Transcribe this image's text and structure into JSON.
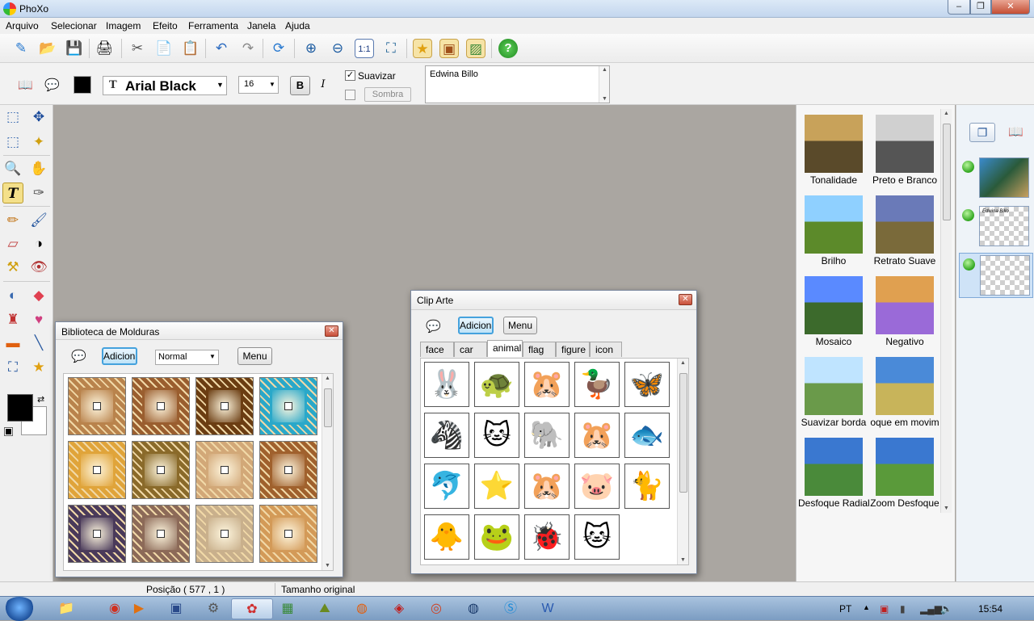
{
  "app": {
    "title": "PhoXo"
  },
  "window_controls": {
    "minimize": "–",
    "restore": "❐",
    "close": "✕"
  },
  "menu": [
    "Arquivo",
    "Selecionar",
    "Imagem",
    "Efeito",
    "Ferramenta",
    "Janela",
    "Ajuda"
  ],
  "toolbar_icons": [
    "new-icon",
    "open-icon",
    "save-icon",
    "scan-icon",
    "cut-icon",
    "copy-icon",
    "paste-icon",
    "undo-icon",
    "redo-icon",
    "rotate-icon",
    "zoom-in-icon",
    "zoom-out-icon",
    "actual-size-icon",
    "fit-window-icon",
    "clipart-icon",
    "frame-icon",
    "effects-icon",
    "help-icon"
  ],
  "text_options": {
    "font_name": "Arial Black",
    "font_size": "16",
    "bold": "B",
    "italic": "I",
    "smooth_label": "Suavizar",
    "shadow_label": "Sombra",
    "text_value": "Edwina Billo",
    "text_color": "#000000"
  },
  "colors": {
    "foreground": "#000000",
    "background": "#ffffff"
  },
  "frames_dialog": {
    "title": "Biblioteca de Molduras",
    "add_button": "Adicionar",
    "mode_select": "Normal",
    "menu_button": "Menu",
    "frame_colors": [
      "#b9834c",
      "#9a5e2f",
      "#6b3d12",
      "#2aa8c9",
      "#e0a43a",
      "#8a6a2a",
      "#d2a878",
      "#a0612d",
      "#4a3a5a",
      "#8c6a58",
      "#c9b08c",
      "#d39a58"
    ]
  },
  "clipart_dialog": {
    "title": "Clip Arte",
    "add_button": "Adicionar",
    "menu_button": "Menu",
    "tabs": [
      "face",
      "car",
      "animal",
      "flag",
      "figure",
      "icon"
    ],
    "selected_tab": "animal",
    "items": [
      "🐰",
      "🐢",
      "🐹",
      "🦆",
      "🦋",
      "🦓",
      "🐱",
      "🐘",
      "🐹",
      "🐟",
      "🐬",
      "⭐",
      "🐹",
      "🐷",
      "🐈",
      "🐥",
      "🐸",
      "🐞",
      "🐱"
    ]
  },
  "effects": [
    {
      "label": "Tonalidade",
      "c1": "#c8a25a",
      "c2": "#5a4a2a"
    },
    {
      "label": "Preto e Branco",
      "c1": "#d0d0d0",
      "c2": "#555555"
    },
    {
      "label": "Brilho",
      "c1": "#8fd0ff",
      "c2": "#5c8a2a"
    },
    {
      "label": "Retrato Suave",
      "c1": "#6a7ab8",
      "c2": "#7a6a3a"
    },
    {
      "label": "Mosaico",
      "c1": "#5a8aff",
      "c2": "#3c6a2c"
    },
    {
      "label": "Negativo",
      "c1": "#e0a050",
      "c2": "#9a6ad8"
    },
    {
      "label": "Suavizar borda",
      "c1": "#bfe4ff",
      "c2": "#6a9a4a"
    },
    {
      "label": "oque em movim",
      "c1": "#4a8ad8",
      "c2": "#c8b45a"
    },
    {
      "label": "Desfoque Radial",
      "c1": "#3a78d0",
      "c2": "#4a8a3a"
    },
    {
      "label": "Zoom Desfoque",
      "c1": "#3a78d0",
      "c2": "#5a9a3a"
    }
  ],
  "layers": {
    "panel_icons": [
      "layers-icon",
      "book-icon"
    ],
    "items": [
      {
        "name": "layer-1",
        "thumb": "photo"
      },
      {
        "name": "layer-2",
        "thumb": "text",
        "text": "Edwina Billo"
      },
      {
        "name": "layer-3",
        "thumb": "empty"
      }
    ]
  },
  "status": {
    "position": "Posição ( 577 , 1 )",
    "size": "Tamanho original"
  },
  "taskbar": {
    "apps": [
      "explorer-icon",
      "opera-icon",
      "media-player-icon",
      "xara-icon",
      "gears-icon",
      "phoxo-icon",
      "picasa-icon",
      "map-icon",
      "firefox-icon",
      "app-icon",
      "chrome-icon",
      "globe-icon",
      "skype-icon",
      "word-icon"
    ],
    "language": "PT",
    "clock": "15:54"
  }
}
